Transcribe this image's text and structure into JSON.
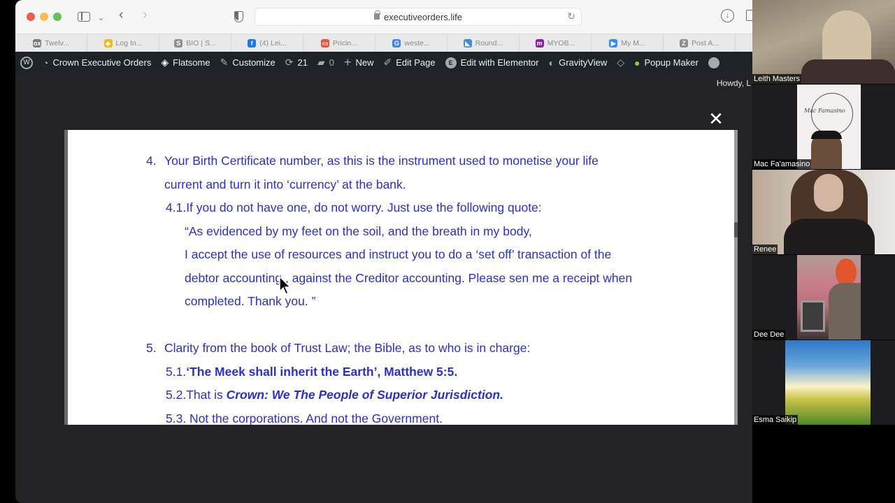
{
  "browser": {
    "url": "executiveorders.life",
    "favorites": [
      {
        "label": "Twelv...",
        "icon": "ox-icon",
        "color": "#7d7d7d",
        "glyph": "ox"
      },
      {
        "label": "Log In...",
        "icon": "binance-icon",
        "color": "#f0b90b",
        "glyph": "◆"
      },
      {
        "label": "BIO | S...",
        "icon": "s-icon",
        "color": "#8f8f8f",
        "glyph": "S"
      },
      {
        "label": "(4) Lei...",
        "icon": "facebook-icon",
        "color": "#1877f2",
        "glyph": "f"
      },
      {
        "label": "Pricin...",
        "icon": "pricing-icon",
        "color": "#e8553e",
        "glyph": "▭"
      },
      {
        "label": "weste...",
        "icon": "google-icon",
        "color": "#4285f4",
        "glyph": "G"
      },
      {
        "label": "Round...",
        "icon": "roundcube-icon",
        "color": "#3b8fd6",
        "glyph": "◣"
      },
      {
        "label": "MYOB...",
        "icon": "myob-icon",
        "color": "#8b1ea8",
        "glyph": "m"
      },
      {
        "label": "My M...",
        "icon": "zoom-icon",
        "color": "#2d8cff",
        "glyph": "▶"
      },
      {
        "label": "Post A...",
        "icon": "z-icon",
        "color": "#8f8f8f",
        "glyph": "Z"
      }
    ]
  },
  "admin_bar": {
    "site_name": "Crown Executive Orders",
    "theme": "Flatsome",
    "customize": "Customize",
    "updates_count": "21",
    "comments_count": "0",
    "new": "New",
    "edit_page": "Edit Page",
    "edit_elementor": "Edit with Elementor",
    "gravityview": "GravityView",
    "popup_maker": "Popup Maker",
    "howdy": "Howdy, L"
  },
  "document": {
    "item4_num": "4.",
    "item4_line1": "Your Birth Certificate number, as this is the instrument used to monetise your life",
    "item4_line2": "current and turn it into ‘currency’ at the bank.",
    "item4_1": "4.1.If you do not have one, do not worry.  Just use the following quote:",
    "quote_line1": "“As evidenced by my feet on the soil, and the breath in my body,",
    "quote_line2": "I accept the use of resources and instruct you to do  a ‘set off’ transaction of the",
    "quote_line3": "debtor accounting , against the Creditor accounting. Please sen me a receipt when",
    "quote_line4": "completed. Thank you.  ”",
    "item5_num": "5.",
    "item5_line1": "Clarity from the book of Trust Law; the Bible, as to who is in charge:",
    "item5_1_prefix": "5.1.",
    "item5_1_bold": "‘The Meek shall inherit the Earth’,  Matthew 5:5.",
    "item5_2_prefix": "5.2.That is ",
    "item5_2_bold": "Crown: We The People of Superior Jurisdiction.",
    "item5_3": "5.3. Not the corporations. And not the Government."
  },
  "participants": [
    {
      "name": "Leith Masters"
    },
    {
      "name": "Mac Fa'amasino"
    },
    {
      "name": "Renee"
    },
    {
      "name": "Dee Dee"
    },
    {
      "name": "Esma Saikip"
    }
  ]
}
